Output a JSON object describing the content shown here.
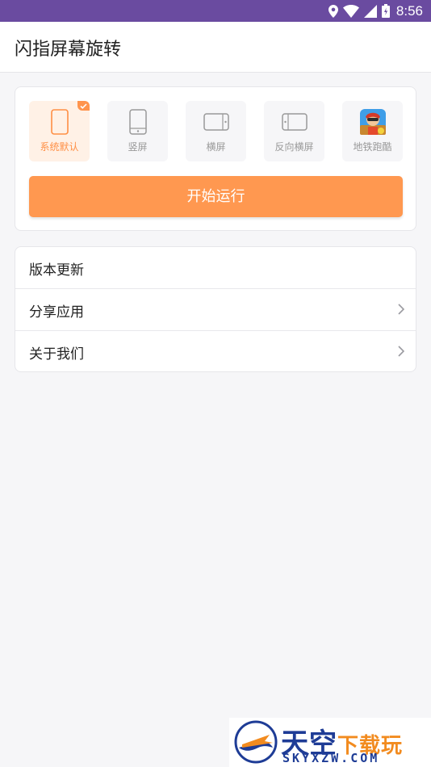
{
  "status_bar": {
    "time": "8:56",
    "icons": [
      "location-icon",
      "wifi-icon",
      "signal-icon",
      "battery-icon"
    ]
  },
  "app_bar": {
    "title": "闪指屏幕旋转"
  },
  "rotation_modes": {
    "selected_index": 0,
    "items": [
      {
        "label": "系统默认",
        "icon": "phone-outline-icon"
      },
      {
        "label": "竖屏",
        "icon": "portrait-phone-icon"
      },
      {
        "label": "横屏",
        "icon": "landscape-phone-icon"
      },
      {
        "label": "反向横屏",
        "icon": "reverse-landscape-phone-icon"
      },
      {
        "label": "地铁跑酷",
        "icon": "subway-surfers-app-icon"
      }
    ]
  },
  "start_button": {
    "label": "开始运行"
  },
  "menu": {
    "items": [
      {
        "label": "版本更新",
        "has_chevron": false
      },
      {
        "label": "分享应用",
        "has_chevron": true
      },
      {
        "label": "关于我们",
        "has_chevron": true
      }
    ]
  },
  "watermark": {
    "brand_main": "天空",
    "brand_sub": "下载玩",
    "domain": "SKYXZW.COM"
  },
  "colors": {
    "status_bar": "#6a4ba0",
    "accent": "#ff9850",
    "selected_bg": "#fff1e6",
    "background": "#f6f6f8"
  }
}
